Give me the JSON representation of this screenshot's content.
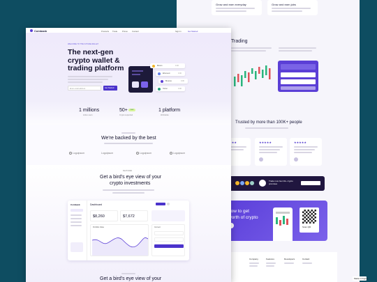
{
  "back": {
    "features": [
      {
        "title": "Grow and earn everyday"
      },
      {
        "title": "Grow and earn jobs"
      }
    ],
    "trading_title": "Trading",
    "testimonials": {
      "heading": "Trusted by more than 100K+ people"
    },
    "app_banner": {
      "title": "Trade now Get 10+ crypto promises"
    },
    "cta": {
      "line1": "now to get",
      "line2": "worth of crypto",
      "qr_label": "Scan QR"
    },
    "footer_cols": [
      "Company",
      "Features",
      "Developers",
      "Contact"
    ],
    "badge": "Made in Figma"
  },
  "front": {
    "nav": {
      "logo": "Coinbank",
      "links": [
        "Products",
        "Trade",
        "Prices",
        "Contact"
      ],
      "signin": "Sign In",
      "cta": "Get Started"
    },
    "hero": {
      "eyebrow": "WELCOME TO THE FUTURE WALLET",
      "title_l1": "The next-gen",
      "title_l2": "crypto wallet &",
      "title_l3": "trading platform",
      "email_placeholder": "Enter email address",
      "cta": "Get Started",
      "coins": [
        {
          "name": "Bitcoin",
          "amount": "0.00"
        },
        {
          "name": "Ethereum",
          "amount": "0.00"
        },
        {
          "name": "Binance",
          "amount": "0.00"
        },
        {
          "name": "Tether",
          "amount": "0.00"
        }
      ]
    },
    "stats": [
      {
        "value": "1 millions",
        "label": "Active users"
      },
      {
        "value": "50+",
        "badge": "new",
        "label": "Crypto supported"
      },
      {
        "value": "1 platform",
        "label": "Worldwide"
      }
    ],
    "backed": {
      "heading": "We're backed by the best",
      "logos": [
        "Logoipsum",
        "Logoipsum",
        "Logoipsum",
        "Logoipsum"
      ]
    },
    "features": {
      "eyebrow": "FEATURES",
      "title_l1": "Get a bird's eye view of your",
      "title_l2": "crypto investments"
    },
    "dashboard": {
      "logo": "Coinbank",
      "title": "Dashboard",
      "balance1": "$8,260",
      "balance2": "$7,672",
      "chart_title": "Portfolio Value",
      "convert": "Convert"
    },
    "features2": {
      "title_l1": "Get a bird's eye view of your"
    }
  },
  "colors": {
    "accent": "#5b3fd6",
    "teal_bg": "#0e4d61"
  }
}
